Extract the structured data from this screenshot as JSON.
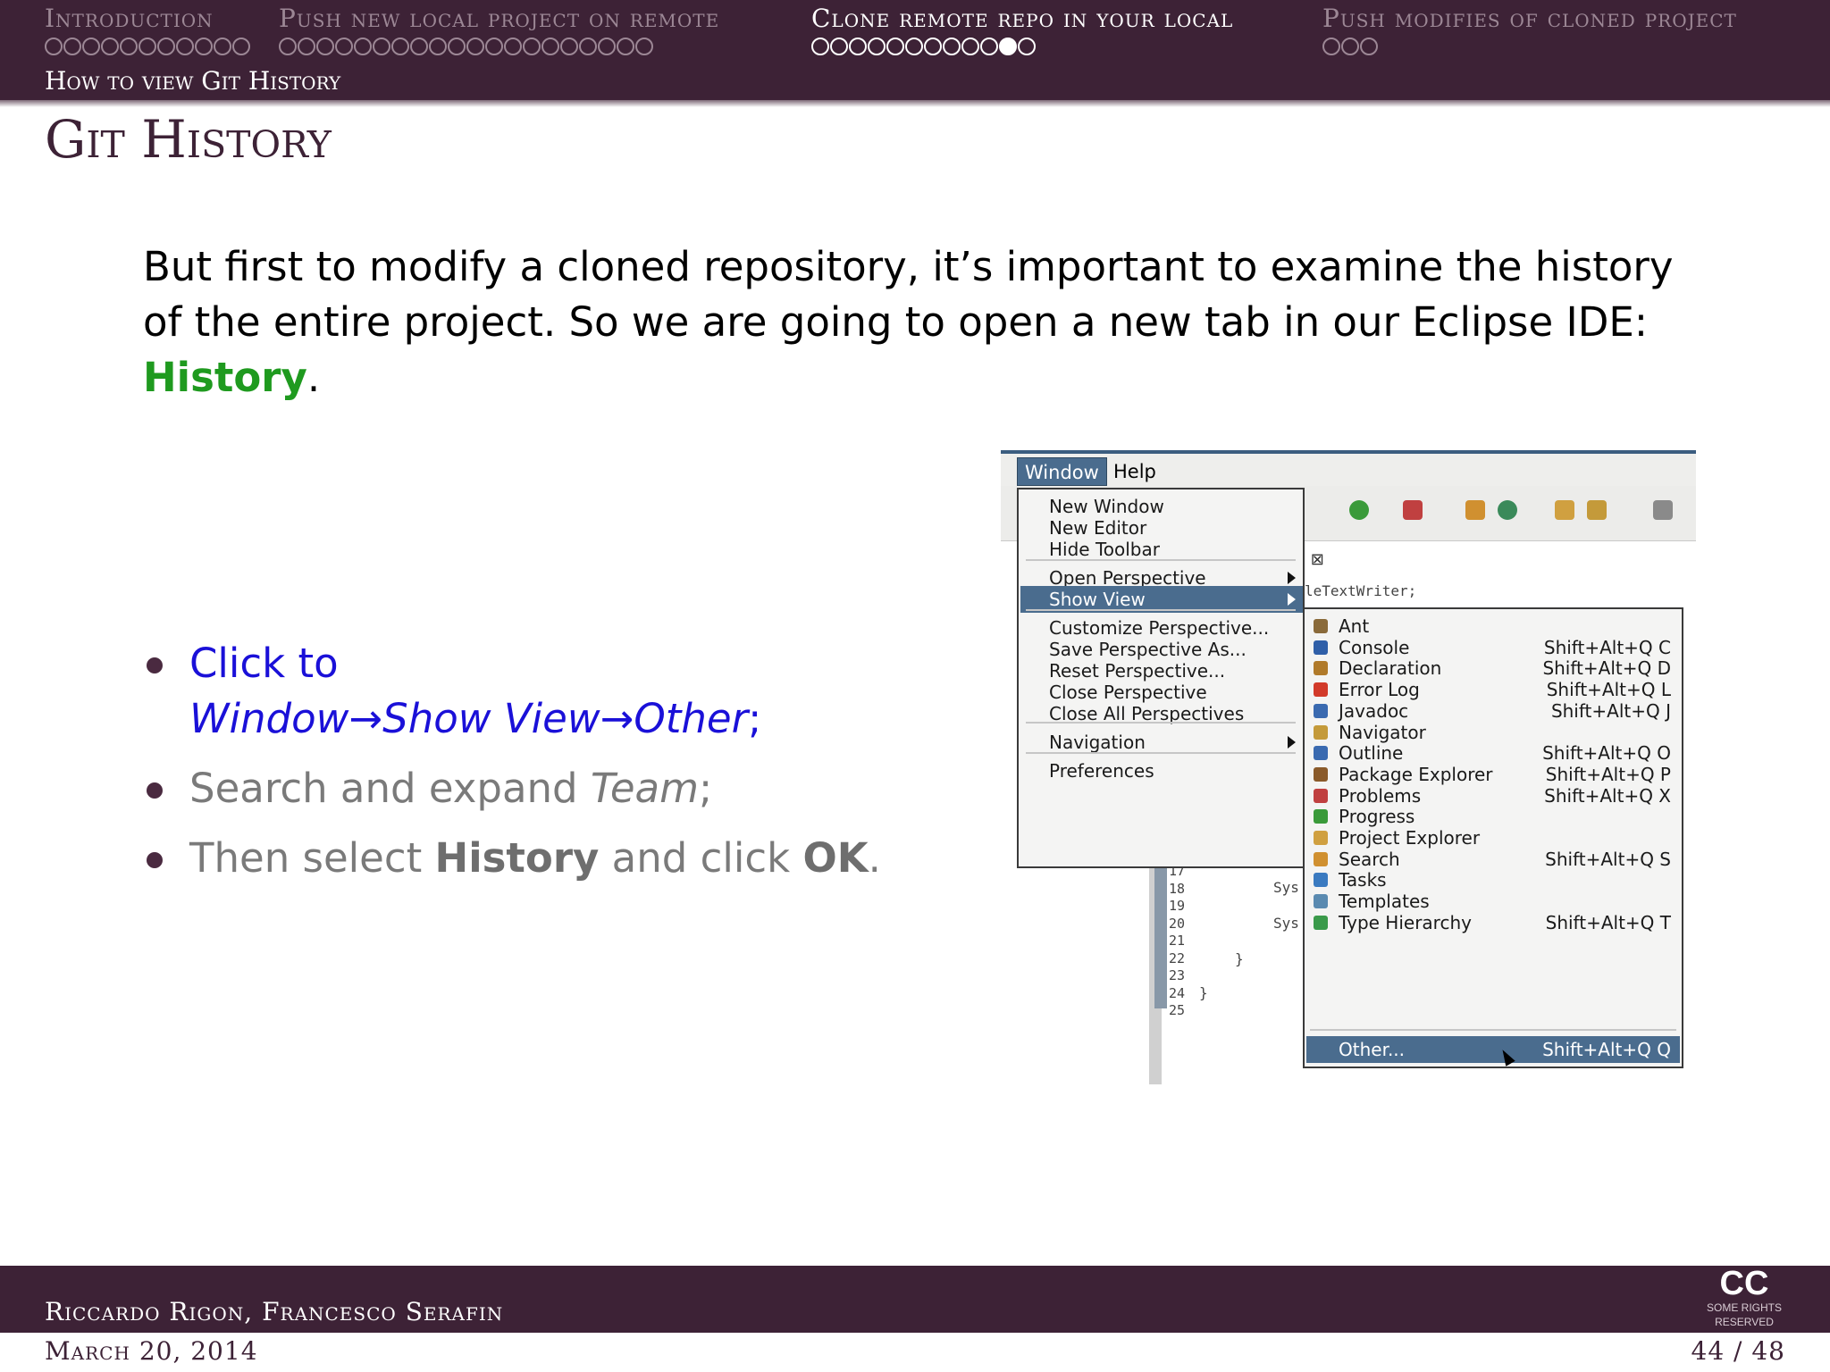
{
  "nav": {
    "sections": [
      {
        "label": "Introduction",
        "dots": 11,
        "filled": -1
      },
      {
        "label": "Push new local project on remote",
        "dots": 20,
        "filled": -1
      },
      {
        "label": "Clone remote repo in your local",
        "dots": 12,
        "filled": 10
      },
      {
        "label": "Push modifies of cloned project",
        "dots": 3,
        "filled": -1
      }
    ],
    "active_section": 2,
    "subsection": "How to view Git History"
  },
  "frame_title": "Git History",
  "intro": {
    "text": "But first to modify a cloned repository, it’s important to examine the history of the entire project. So we are going to open a new tab in our Eclipse IDE: ",
    "highlight": "History",
    "end": "."
  },
  "bullets": {
    "b1_prefix": "Click to",
    "b1_path": "Window→Show View→Other",
    "b1_end": ";",
    "b2_prefix": "Search and expand ",
    "b2_em": "Team",
    "b2_end": ";",
    "b3_a": "Then select ",
    "b3_b": "History",
    "b3_c": " and click ",
    "b3_d": "OK",
    "b3_e": "."
  },
  "eclipse": {
    "menubar": {
      "window": "Window",
      "help": "Help"
    },
    "editor_tab": "a ⊠",
    "code_line": "leTextWriter;",
    "line_numbers": "17\n18\n19\n20\n21\n22\n23\n24\n25",
    "code_sys1": "Sys",
    "code_sys2": "Sys",
    "code_brace1": "}",
    "code_brace2": "}",
    "window_menu": [
      {
        "label": "New Window",
        "submenu": false,
        "selected": false
      },
      {
        "label": "New Editor",
        "submenu": false,
        "selected": false
      },
      {
        "label": "Hide Toolbar",
        "submenu": false,
        "selected": false
      },
      {
        "label": "Open Perspective",
        "submenu": true,
        "selected": false
      },
      {
        "label": "Show View",
        "submenu": true,
        "selected": true
      },
      {
        "label": "Customize Perspective...",
        "submenu": false,
        "selected": false
      },
      {
        "label": "Save Perspective As...",
        "submenu": false,
        "selected": false
      },
      {
        "label": "Reset Perspective...",
        "submenu": false,
        "selected": false
      },
      {
        "label": "Close Perspective",
        "submenu": false,
        "selected": false
      },
      {
        "label": "Close All Perspectives",
        "submenu": false,
        "selected": false
      },
      {
        "label": "Navigation",
        "submenu": true,
        "selected": false
      },
      {
        "label": "Preferences",
        "submenu": false,
        "selected": false
      }
    ],
    "show_view_menu": [
      {
        "label": "Ant",
        "shortcut": "",
        "icon_color": "#8a6a3a"
      },
      {
        "label": "Console",
        "shortcut": "Shift+Alt+Q C",
        "icon_color": "#2f5fa8"
      },
      {
        "label": "Declaration",
        "shortcut": "Shift+Alt+Q D",
        "icon_color": "#b07a2a"
      },
      {
        "label": "Error Log",
        "shortcut": "Shift+Alt+Q L",
        "icon_color": "#d23a2a"
      },
      {
        "label": "Javadoc",
        "shortcut": "Shift+Alt+Q J",
        "icon_color": "#3a6ab0"
      },
      {
        "label": "Navigator",
        "shortcut": "",
        "icon_color": "#c49a3a"
      },
      {
        "label": "Outline",
        "shortcut": "Shift+Alt+Q O",
        "icon_color": "#3a6ab0"
      },
      {
        "label": "Package Explorer",
        "shortcut": "Shift+Alt+Q P",
        "icon_color": "#8a5a2a"
      },
      {
        "label": "Problems",
        "shortcut": "Shift+Alt+Q X",
        "icon_color": "#c04040"
      },
      {
        "label": "Progress",
        "shortcut": "",
        "icon_color": "#3a9a3a"
      },
      {
        "label": "Project Explorer",
        "shortcut": "",
        "icon_color": "#d0a040"
      },
      {
        "label": "Search",
        "shortcut": "Shift+Alt+Q S",
        "icon_color": "#d09030"
      },
      {
        "label": "Tasks",
        "shortcut": "",
        "icon_color": "#3a7ac0"
      },
      {
        "label": "Templates",
        "shortcut": "",
        "icon_color": "#5a8ab0"
      },
      {
        "label": "Type Hierarchy",
        "shortcut": "Shift+Alt+Q T",
        "icon_color": "#3a9a4a"
      },
      {
        "label": "Other...",
        "shortcut": "Shift+Alt+Q Q",
        "icon_color": ""
      }
    ]
  },
  "footer": {
    "authors": "Riccardo Rigon, Francesco Serafin",
    "date": "March 20, 2014",
    "page": "44 / 48",
    "cc_big": "CC",
    "cc_small": "SOME RIGHTS RESERVED"
  },
  "colors": {
    "theme_purple": "#3d2236",
    "highlight_green": "#1f9a1f",
    "link_blue": "#1a10d8",
    "menu_selection": "#4a6c8e"
  }
}
